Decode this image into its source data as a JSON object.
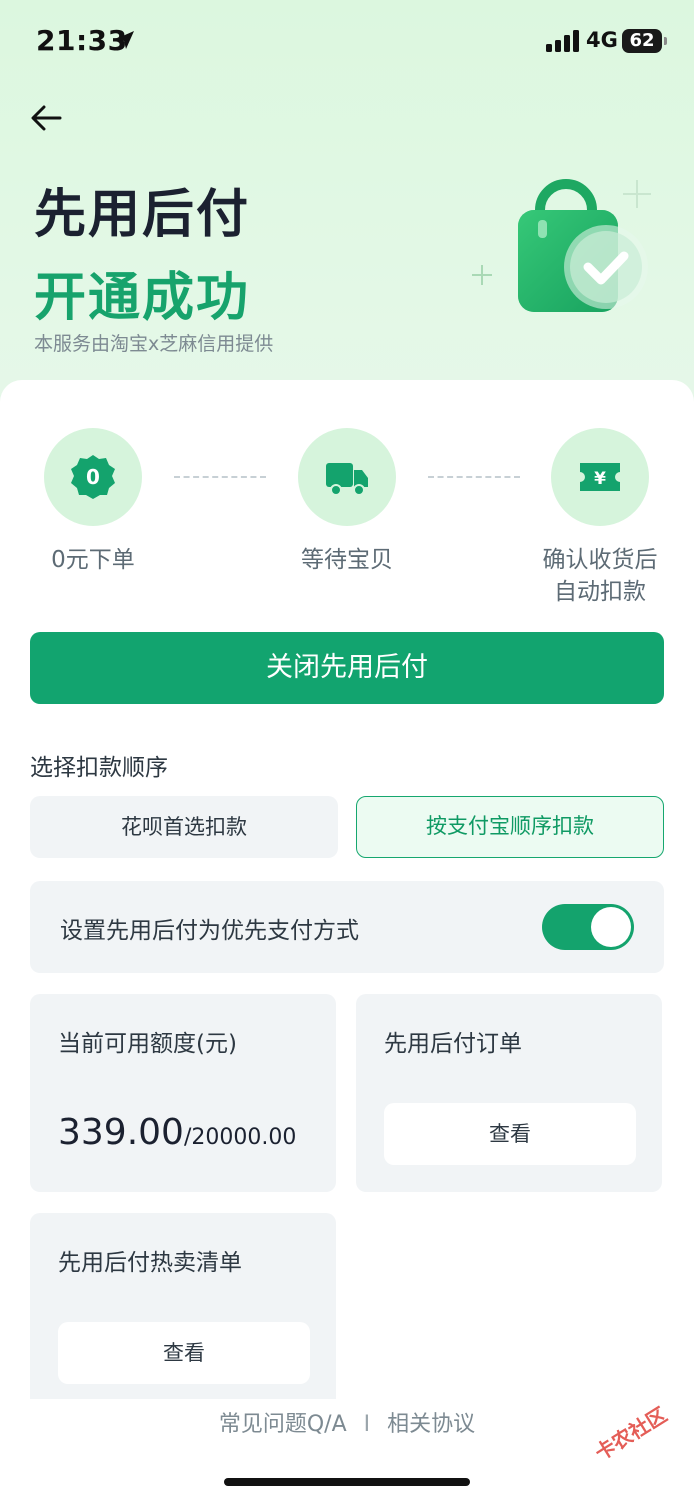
{
  "status_bar": {
    "time": "21:33",
    "network": "4G",
    "battery": "62"
  },
  "header": {
    "title": "先用后付",
    "status": "开通成功",
    "subtitle": "本服务由淘宝x芝麻信用提供"
  },
  "steps": [
    {
      "label": "0元下单",
      "icon": "zero-badge-icon",
      "badge_text": "0"
    },
    {
      "label": "等待宝贝",
      "icon": "truck-icon"
    },
    {
      "label_line1": "确认收货后",
      "label_line2": "自动扣款",
      "icon": "yuan-ticket-icon",
      "badge_text": "¥"
    }
  ],
  "primary_action": {
    "label": "关闭先用后付"
  },
  "deduction_order": {
    "label": "选择扣款顺序",
    "options": [
      {
        "label": "花呗首选扣款",
        "selected": false
      },
      {
        "label": "按支付宝顺序扣款",
        "selected": true
      }
    ]
  },
  "preferred_payment": {
    "label": "设置先用后付为优先支付方式",
    "enabled": true
  },
  "credit": {
    "title": "当前可用额度(元)",
    "available": "339.00",
    "separator": "/",
    "total": "20000.00"
  },
  "orders": {
    "title": "先用后付订单",
    "button": "查看"
  },
  "hot_list": {
    "title": "先用后付热卖清单",
    "button": "查看"
  },
  "footer": {
    "faq": "常见问题Q/A",
    "separator": "I",
    "agreement": "相关协议"
  },
  "watermark": "卡农社区",
  "colors": {
    "accent": "#12a46f",
    "accent_light": "#d6f4dc",
    "title_green": "#17a36c",
    "background": "#e8f8ea"
  }
}
